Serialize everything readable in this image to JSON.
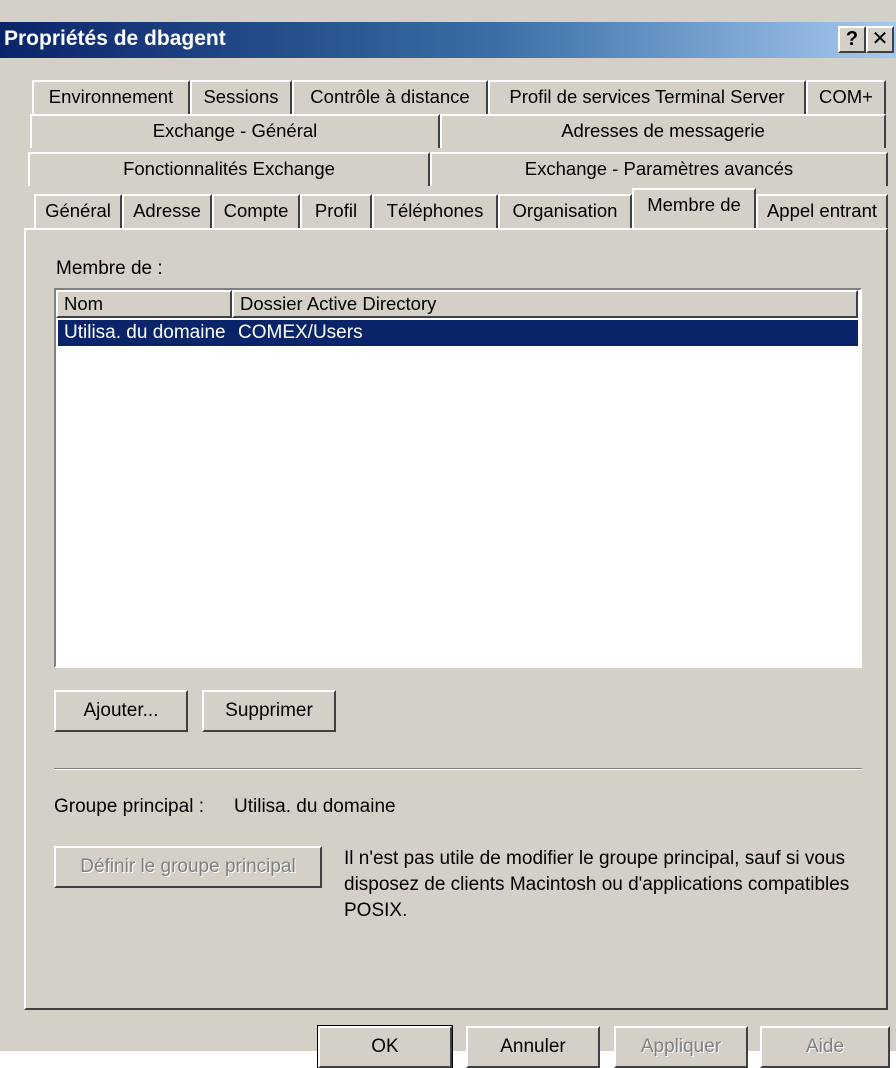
{
  "window": {
    "title": "Propriétés de dbagent",
    "help_btn": "?",
    "close_btn": "✕"
  },
  "tabs": {
    "row1": [
      "Environnement",
      "Sessions",
      "Contrôle à distance",
      "Profil de services Terminal Server",
      "COM+"
    ],
    "row2": [
      "Exchange - Général",
      "Adresses de messagerie"
    ],
    "row3": [
      "Fonctionnalités Exchange",
      "Exchange - Paramètres avancés"
    ],
    "row4": [
      "Général",
      "Adresse",
      "Compte",
      "Profil",
      "Téléphones",
      "Organisation",
      "Membre de",
      "Appel entrant"
    ],
    "active": "Membre de"
  },
  "member_of": {
    "label": "Membre de :",
    "columns": [
      "Nom",
      "Dossier Active Directory"
    ],
    "rows": [
      {
        "name": "Utilisa. du domaine",
        "folder": "COMEX/Users"
      }
    ],
    "add_button": "Ajouter...",
    "remove_button": "Supprimer"
  },
  "primary_group": {
    "label": "Groupe principal :",
    "value": "Utilisa. du domaine",
    "set_button": "Définir le groupe principal",
    "note_line1": "Il n'est pas utile de modifier le groupe principal, sauf si vous",
    "note_line2": "disposez de clients Macintosh ou d'applications compatibles",
    "note_line3": "POSIX."
  },
  "footer": {
    "ok": "OK",
    "cancel": "Annuler",
    "apply": "Appliquer",
    "help": "Aide"
  }
}
